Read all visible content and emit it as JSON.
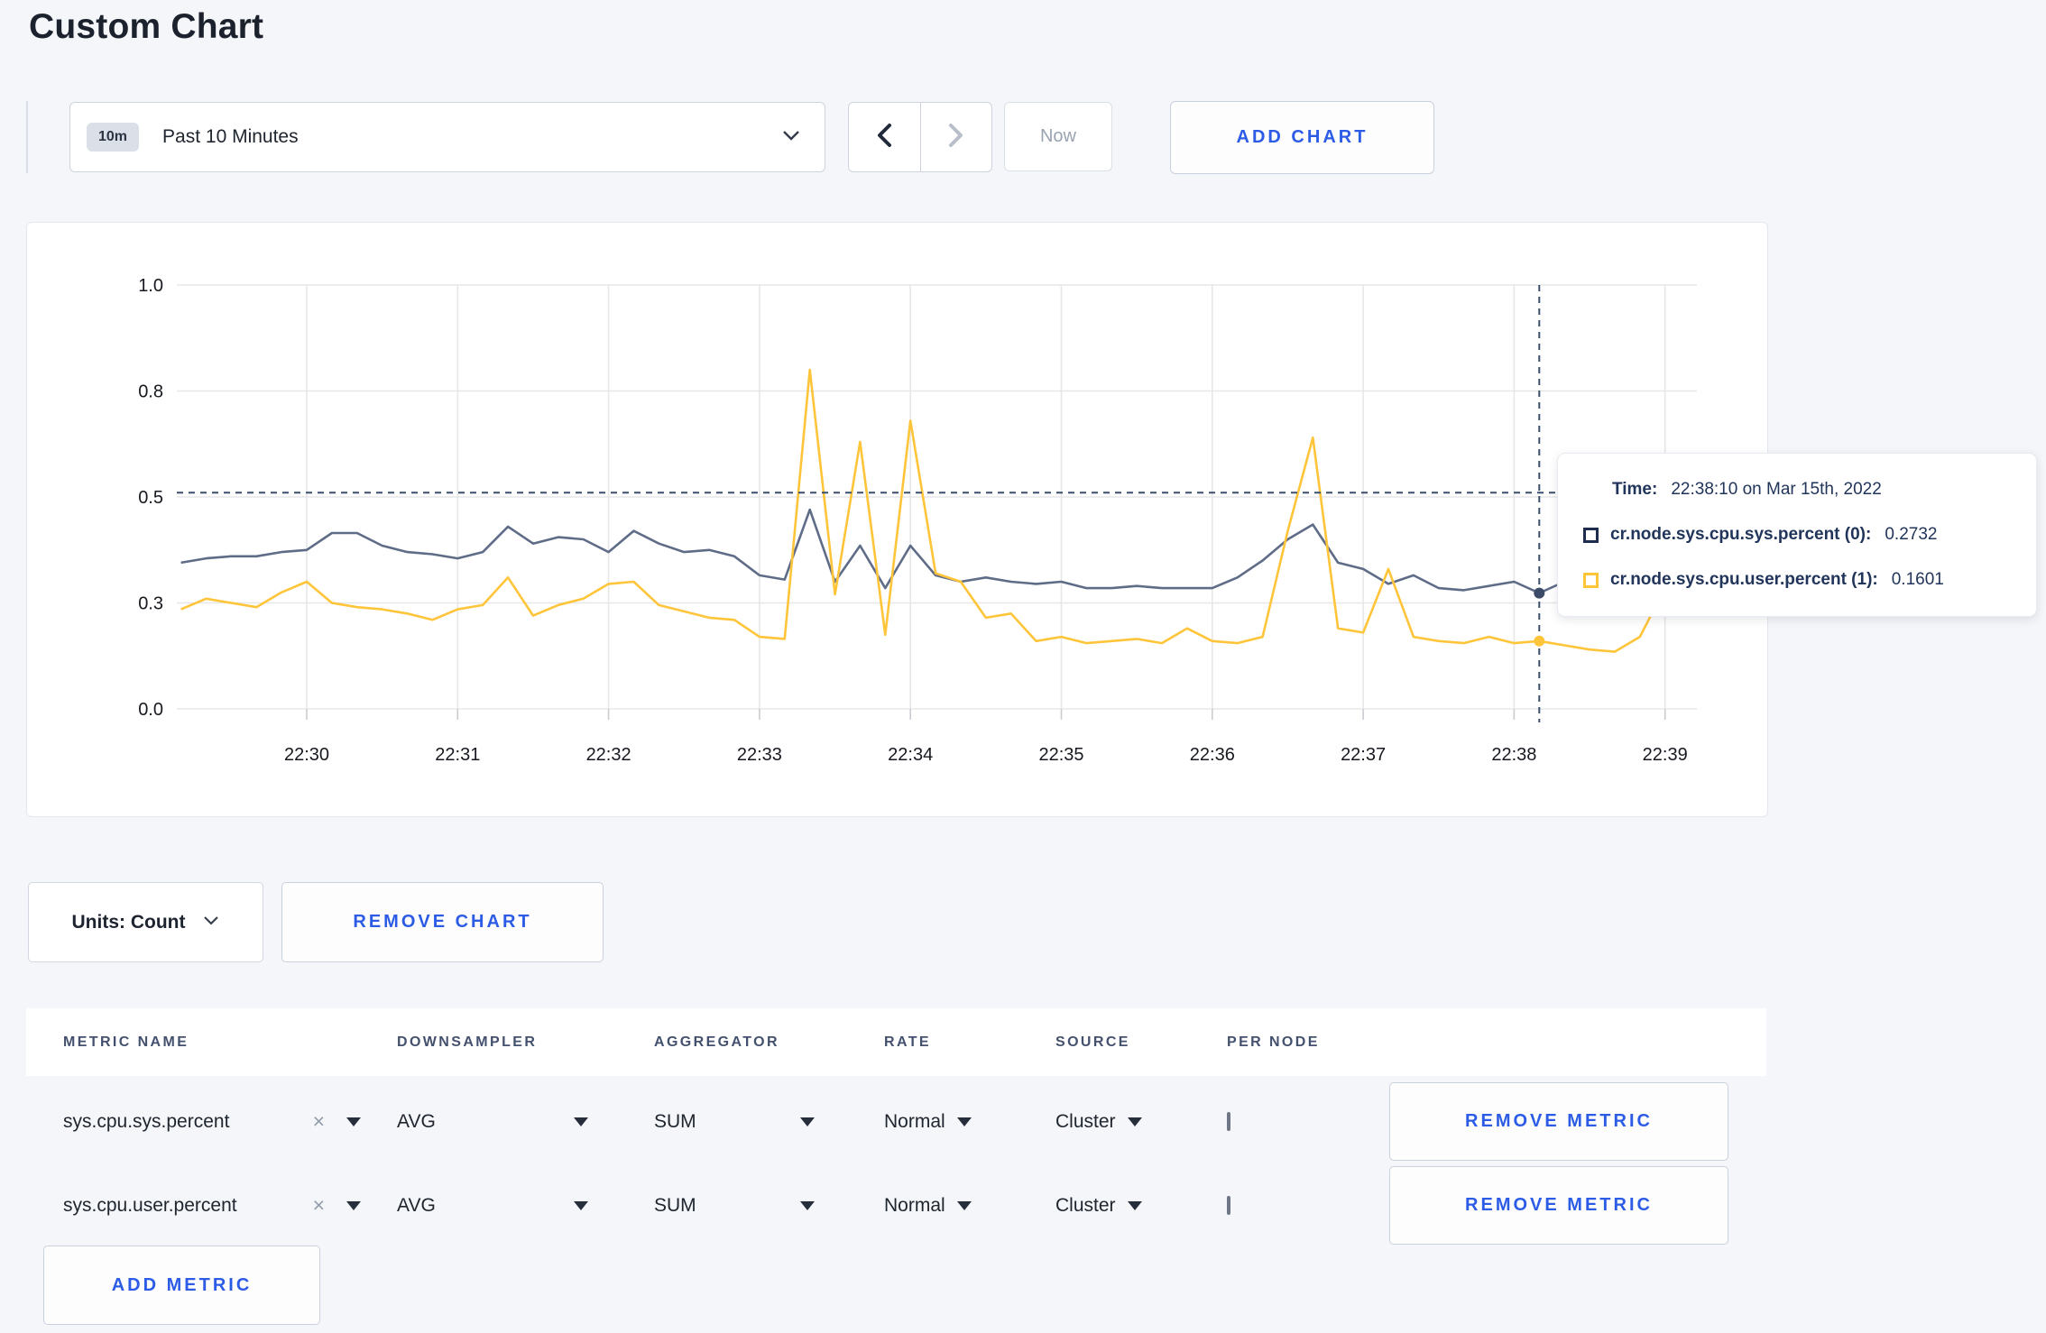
{
  "page": {
    "title": "Custom Chart"
  },
  "toolbar": {
    "time_selector": {
      "badge": "10m",
      "label": "Past 10 Minutes"
    },
    "now_label": "Now",
    "add_chart_label": "ADD CHART"
  },
  "colors": {
    "accent_blue": "#2c5ce5",
    "series_sys_line": "#5f6c87",
    "series_user_line": "#ffc53a",
    "legend_sys_swatch": "#1e2d4f",
    "legend_user_swatch": "#ffc53a",
    "crosshair": "#3a4f6e",
    "gridline": "#e7e7e7",
    "axis_tick": "#c9ccd1",
    "axis_text": "#16191f"
  },
  "chart": {
    "y_tick_labels": [
      "1.0",
      "0.8",
      "0.5",
      "0.3",
      "0.0"
    ],
    "x_tick_labels": [
      "22:30",
      "22:31",
      "22:32",
      "22:33",
      "22:34",
      "22:35",
      "22:36",
      "22:37",
      "22:38",
      "22:39"
    ],
    "tooltip": {
      "time_label": "Time:",
      "time_value": "22:38:10 on Mar 15th, 2022",
      "series": [
        {
          "name": "cr.node.sys.cpu.sys.percent (0):",
          "value": "0.2732"
        },
        {
          "name": "cr.node.sys.cpu.user.percent (1):",
          "value": "0.1601"
        }
      ]
    }
  },
  "chart_data": {
    "type": "line",
    "title": "",
    "xlabel": "",
    "ylabel": "",
    "ylim": [
      0,
      1
    ],
    "y_grid_values": [
      1.0,
      0.75,
      0.5,
      0.25,
      0.0
    ],
    "x_start": "22:29:10",
    "x_end": "22:39:10",
    "interval_seconds": 10,
    "x_ticks": [
      "22:30",
      "22:31",
      "22:32",
      "22:33",
      "22:34",
      "22:35",
      "22:36",
      "22:37",
      "22:38",
      "22:39"
    ],
    "legend_position": "tooltip",
    "grid": true,
    "crosshair": {
      "time": "22:38:10",
      "y_guide_value": 0.51,
      "sys_value": 0.2732,
      "user_value": 0.1601
    },
    "series": [
      {
        "name": "cr.node.sys.cpu.sys.percent (0)",
        "values": [
          0.345,
          0.355,
          0.36,
          0.36,
          0.37,
          0.375,
          0.415,
          0.415,
          0.385,
          0.37,
          0.365,
          0.355,
          0.37,
          0.43,
          0.39,
          0.405,
          0.4,
          0.37,
          0.42,
          0.39,
          0.37,
          0.375,
          0.36,
          0.315,
          0.305,
          0.47,
          0.3,
          0.385,
          0.285,
          0.385,
          0.315,
          0.3,
          0.31,
          0.3,
          0.295,
          0.3,
          0.285,
          0.285,
          0.29,
          0.285,
          0.285,
          0.285,
          0.31,
          0.35,
          0.4,
          0.435,
          0.345,
          0.33,
          0.295,
          0.315,
          0.285,
          0.28,
          0.29,
          0.3,
          0.2732,
          0.3,
          0.31,
          0.3,
          0.295,
          0.3,
          0.3
        ]
      },
      {
        "name": "cr.node.sys.cpu.user.percent (1)",
        "values": [
          0.235,
          0.26,
          0.25,
          0.24,
          0.275,
          0.3,
          0.25,
          0.24,
          0.235,
          0.225,
          0.21,
          0.235,
          0.245,
          0.31,
          0.22,
          0.245,
          0.26,
          0.295,
          0.3,
          0.245,
          0.23,
          0.215,
          0.21,
          0.17,
          0.165,
          0.8,
          0.27,
          0.63,
          0.175,
          0.68,
          0.32,
          0.3,
          0.215,
          0.225,
          0.16,
          0.17,
          0.155,
          0.16,
          0.165,
          0.155,
          0.19,
          0.16,
          0.155,
          0.17,
          0.42,
          0.64,
          0.19,
          0.18,
          0.33,
          0.17,
          0.16,
          0.155,
          0.17,
          0.155,
          0.1601,
          0.15,
          0.14,
          0.135,
          0.17,
          0.285,
          0.235
        ]
      }
    ]
  },
  "units_bar": {
    "units_label": "Units: Count",
    "remove_chart_label": "REMOVE CHART"
  },
  "metrics_table": {
    "headers": [
      "METRIC NAME",
      "DOWNSAMPLER",
      "AGGREGATOR",
      "RATE",
      "SOURCE",
      "PER NODE"
    ],
    "rows": [
      {
        "metric": "sys.cpu.sys.percent",
        "clear": "×",
        "downsampler": "AVG",
        "aggregator": "SUM",
        "rate": "Normal",
        "source": "Cluster",
        "per_node_checked": false,
        "remove_label": "REMOVE METRIC"
      },
      {
        "metric": "sys.cpu.user.percent",
        "clear": "×",
        "downsampler": "AVG",
        "aggregator": "SUM",
        "rate": "Normal",
        "source": "Cluster",
        "per_node_checked": false,
        "remove_label": "REMOVE METRIC"
      }
    ],
    "add_metric_label": "ADD METRIC"
  }
}
